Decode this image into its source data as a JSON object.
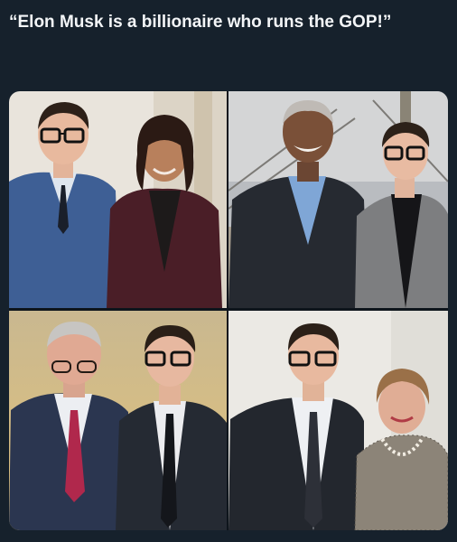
{
  "post": {
    "caption": "“Elon Musk is a billionaire who runs the GOP!”"
  },
  "photos": [
    {
      "name": "photo-top-left"
    },
    {
      "name": "photo-top-right"
    },
    {
      "name": "photo-bottom-left"
    },
    {
      "name": "photo-bottom-right"
    }
  ]
}
